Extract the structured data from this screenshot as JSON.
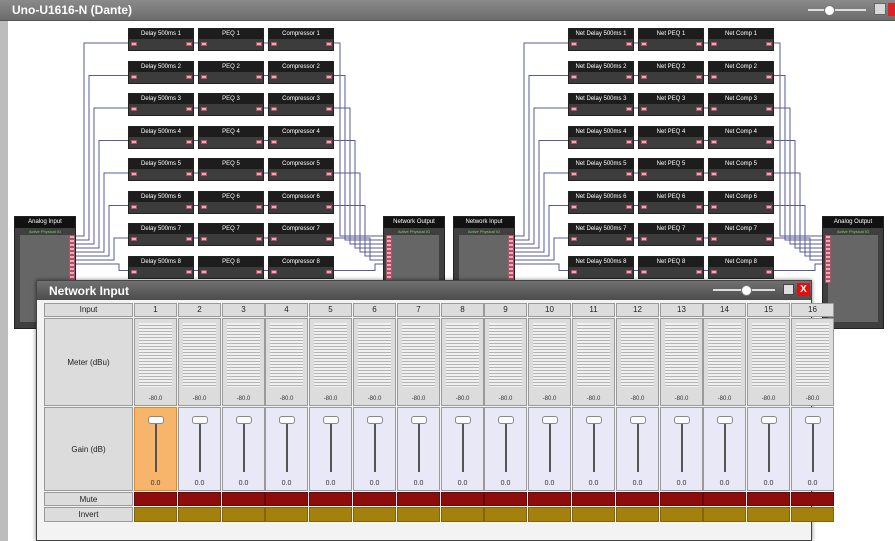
{
  "window": {
    "title": "Uno-U1616-N (Dante)"
  },
  "routing": {
    "left_groups": [
      {
        "labels": [
          "Delay 500ms 1",
          "Delay 500ms 2",
          "Delay 500ms 3",
          "Delay 500ms 4",
          "Delay 500ms 5",
          "Delay 500ms 6",
          "Delay 500ms 7",
          "Delay 500ms 8"
        ]
      },
      {
        "labels": [
          "PEQ 1",
          "PEQ 2",
          "PEQ 3",
          "PEQ 4",
          "PEQ 5",
          "PEQ 6",
          "PEQ 7",
          "PEQ 8"
        ]
      },
      {
        "labels": [
          "Compressor 1",
          "Compressor 2",
          "Compressor 3",
          "Compressor 4",
          "Compressor 5",
          "Compressor 6",
          "Compressor 7",
          "Compressor 8"
        ]
      }
    ],
    "right_groups": [
      {
        "labels": [
          "Net Delay 500ms 1",
          "Net Delay 500ms 2",
          "Net Delay 500ms 3",
          "Net Delay 500ms 4",
          "Net Delay 500ms 5",
          "Net Delay 500ms 6",
          "Net Delay 500ms 7",
          "Net Delay 500ms 8"
        ]
      },
      {
        "labels": [
          "Net PEQ 1",
          "Net PEQ 2",
          "Net PEQ 3",
          "Net PEQ 4",
          "Net PEQ 5",
          "Net PEQ 6",
          "Net PEQ 7",
          "Net PEQ 8"
        ]
      },
      {
        "labels": [
          "Net Comp 1",
          "Net Comp 2",
          "Net Comp 3",
          "Net Comp 4",
          "Net Comp 5",
          "Net Comp 6",
          "Net Comp 7",
          "Net Comp 8"
        ]
      }
    ],
    "io_blocks": [
      {
        "title": "Analog Input",
        "subtitle": "Active Physical IO"
      },
      {
        "title": "Network Output",
        "subtitle": "Active Physical IO"
      },
      {
        "title": "Network Input",
        "subtitle": "Active Physical IO"
      },
      {
        "title": "Analog Output",
        "subtitle": "Active Physical IO"
      }
    ],
    "wire_color": "#5a5a9a"
  },
  "dialog": {
    "title": "Network Input",
    "close_glyph": "X",
    "header_label": "Input",
    "meter_label": "Meter (dBu)",
    "gain_label": "Gain (dB)",
    "mute_label": "Mute",
    "invert_label": "Invert",
    "selected_channel": 1,
    "colors": {
      "mute": "#8d0c0c",
      "invert": "#a4800d",
      "selected": "#f6b56a"
    },
    "channels": [
      {
        "num": "1",
        "meter": "-80.0",
        "gain": "0.0",
        "level": 1.0
      },
      {
        "num": "2",
        "meter": "-80.0",
        "gain": "0.0",
        "level": 1.0
      },
      {
        "num": "3",
        "meter": "-80.0",
        "gain": "0.0",
        "level": 1.0
      },
      {
        "num": "4",
        "meter": "-80.0",
        "gain": "0.0",
        "level": 1.0
      },
      {
        "num": "5",
        "meter": "-80.0",
        "gain": "0.0",
        "level": 1.0
      },
      {
        "num": "6",
        "meter": "-80.0",
        "gain": "0.0",
        "level": 1.0
      },
      {
        "num": "7",
        "meter": "-80.0",
        "gain": "0.0",
        "level": 1.0
      },
      {
        "num": "8",
        "meter": "-80.0",
        "gain": "0.0",
        "level": 1.0
      },
      {
        "num": "9",
        "meter": "-80.0",
        "gain": "0.0",
        "level": 1.0
      },
      {
        "num": "10",
        "meter": "-80.0",
        "gain": "0.0",
        "level": 1.0
      },
      {
        "num": "11",
        "meter": "-80.0",
        "gain": "0.0",
        "level": 1.0
      },
      {
        "num": "12",
        "meter": "-80.0",
        "gain": "0.0",
        "level": 1.0
      },
      {
        "num": "13",
        "meter": "-80.0",
        "gain": "0.0",
        "level": 1.0
      },
      {
        "num": "14",
        "meter": "-80.0",
        "gain": "0.0",
        "level": 1.0
      },
      {
        "num": "15",
        "meter": "-80.0",
        "gain": "0.0",
        "level": 1.0
      },
      {
        "num": "16",
        "meter": "-80.0",
        "gain": "0.0",
        "level": 1.0
      }
    ]
  }
}
